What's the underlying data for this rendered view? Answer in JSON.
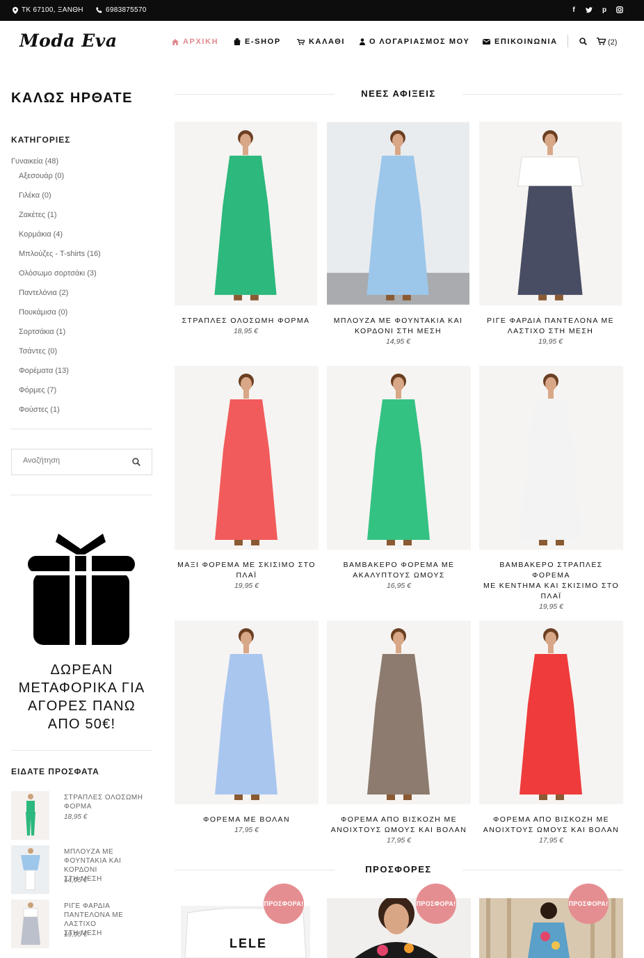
{
  "topbar": {
    "address": "ΤΚ 67100, ΞΑΝΘΗ",
    "phone": "6983875570",
    "social": [
      "facebook-icon",
      "twitter-icon",
      "pinterest-icon",
      "instagram-icon"
    ]
  },
  "header": {
    "logo": "Moda Eva",
    "nav": [
      "ΑΡΧΙΚΗ",
      "E-SHOP",
      "ΚΑΛΑΘΙ",
      "Ο ΛΟΓΑΡΙΑΣΜΟΣ ΜΟΥ",
      "ΕΠΙΚΟΙΝΩΝΙΑ"
    ],
    "cart_count": "(2)"
  },
  "colors": {
    "accent": "#e08a8f",
    "badge": "#e58e91",
    "topbar": "#0d0d0d"
  },
  "sidebar": {
    "welcome": "ΚΑΛΩΣ ΗΡΘΑΤΕ",
    "categories_title": "ΚΑΤΗΓΟΡΙΕΣ",
    "parent": "Γυναικεία (48)",
    "categories": [
      "Αξεσουάρ (0)",
      "Γιλέκα (0)",
      "Ζακέτες (1)",
      "Κορμάκια (4)",
      "Μπλούζες - T-shirts (16)",
      "Ολόσωμο σορτσάκι (3)",
      "Παντελόνια (2)",
      "Πουκάμισα (0)",
      "Σορτσάκια (1)",
      "Τσάντες (0)",
      "Φορέματα (13)",
      "Φόρμες (7)",
      "Φούστες (1)"
    ],
    "search_placeholder": "Αναζήτηση",
    "promo_lines": [
      "ΔΩΡΕΑΝ",
      "ΜΕΤΑΦΟΡΙΚΑ ΓΙΑ",
      "ΑΓΟΡΕΣ ΠΑΝΩ",
      "ΑΠΟ 50€!"
    ],
    "recent_title": "ΕΙΔΑΤΕ ΠΡΟΣΦΑΤΑ",
    "recent": [
      {
        "name_lines": [
          "ΣΤΡΑΠΛΕΣ ΟΛΟΣΩΜΗ",
          "ΦΟΡΜΑ"
        ],
        "price": "18,95 €"
      },
      {
        "name_lines": [
          "ΜΠΛΟΥΖΑ ΜΕ",
          "ΦΟΥΝΤΑΚΙΑ ΚΑΙ ΚΟΡΔΟΝΙ",
          "ΣΤΗ ΜΕΣΗ"
        ],
        "price": "14,95 €"
      },
      {
        "name_lines": [
          "ΡΙΓΕ ΦΑΡΔΙΑ",
          "ΠΑΝΤΕΛΟΝΑ ΜΕ ΛΑΣΤΙΧΟ",
          "ΣΤΗ ΜΕΣΗ"
        ],
        "price": "19,95 €"
      }
    ]
  },
  "main": {
    "new_title": "ΝΕΕΣ ΑΦΙΞΕΙΣ",
    "products": [
      {
        "name_lines": [
          "ΣΤΡΑΠΛΕΣ ΟΛΟΣΩΜΗ ΦΟΡΜΑ"
        ],
        "price": "18,95 €",
        "color": "#2db87d"
      },
      {
        "name_lines": [
          "ΜΠΛΟΥΖΑ ΜΕ ΦΟΥΝΤΑΚΙΑ ΚΑΙ",
          "ΚΟΡΔΟΝΙ ΣΤΗ ΜΕΣΗ"
        ],
        "price": "14,95 €",
        "color": "#9cc7ea"
      },
      {
        "name_lines": [
          "ΡΙΓΕ ΦΑΡΔΙΑ ΠΑΝΤΕΛΟΝΑ ΜΕ",
          "ΛΑΣΤΙΧΟ ΣΤΗ ΜΕΣΗ"
        ],
        "price": "19,95 €",
        "color": "#2a2f4a"
      },
      {
        "name_lines": [
          "ΜΑΞΙ ΦΟΡΕΜΑ ΜΕ ΣΚΙΣΙΜΟ ΣΤΟ",
          "ΠΛΑΪ"
        ],
        "price": "19,95 €",
        "color": "#f25b5b"
      },
      {
        "name_lines": [
          "ΒΑΜΒΑΚΕΡΟ ΦΟΡΕΜΑ ΜΕ",
          "ΑΚΑΛΥΠΤΟΥΣ ΩΜΟΥΣ"
        ],
        "price": "16,95 €",
        "color": "#34c283"
      },
      {
        "name_lines": [
          "ΒΑΜΒΑΚΕΡΟ ΣΤΡΑΠΛΕΣ ΦΟΡΕΜΑ",
          "ΜΕ ΚΕΝΤΗΜΑ ΚΑΙ ΣΚΙΣΙΜΟ ΣΤΟ",
          "ΠΛΑΪ"
        ],
        "price": "19,95 €",
        "color": "#f3f3f3"
      },
      {
        "name_lines": [
          "ΦΟΡΕΜΑ ΜΕ ΒΟΛΑΝ"
        ],
        "price": "17,95 €",
        "color": "#a9c6ef"
      },
      {
        "name_lines": [
          "ΦΟΡΕΜΑ ΑΠΟ ΒΙΣΚΟΖΗ ΜΕ",
          "ΑΝΟΙΧΤΟΥΣ ΩΜΟΥΣ ΚΑΙ ΒΟΛΑΝ"
        ],
        "price": "17,95 €",
        "color": "#8c7b6e"
      },
      {
        "name_lines": [
          "ΦΟΡΕΜΑ ΑΠΟ ΒΙΣΚΟΖΗ ΜΕ",
          "ΑΝΟΙΧΤΟΥΣ ΩΜΟΥΣ ΚΑΙ ΒΟΛΑΝ"
        ],
        "price": "17,95 €",
        "color": "#ef3b3b"
      }
    ],
    "offers_title": "ΠΡΟΣΦΟΡΕΣ",
    "offer_badge": "ΠΡΟΣΦΟΡΑ!",
    "offer_print": "LELE"
  }
}
